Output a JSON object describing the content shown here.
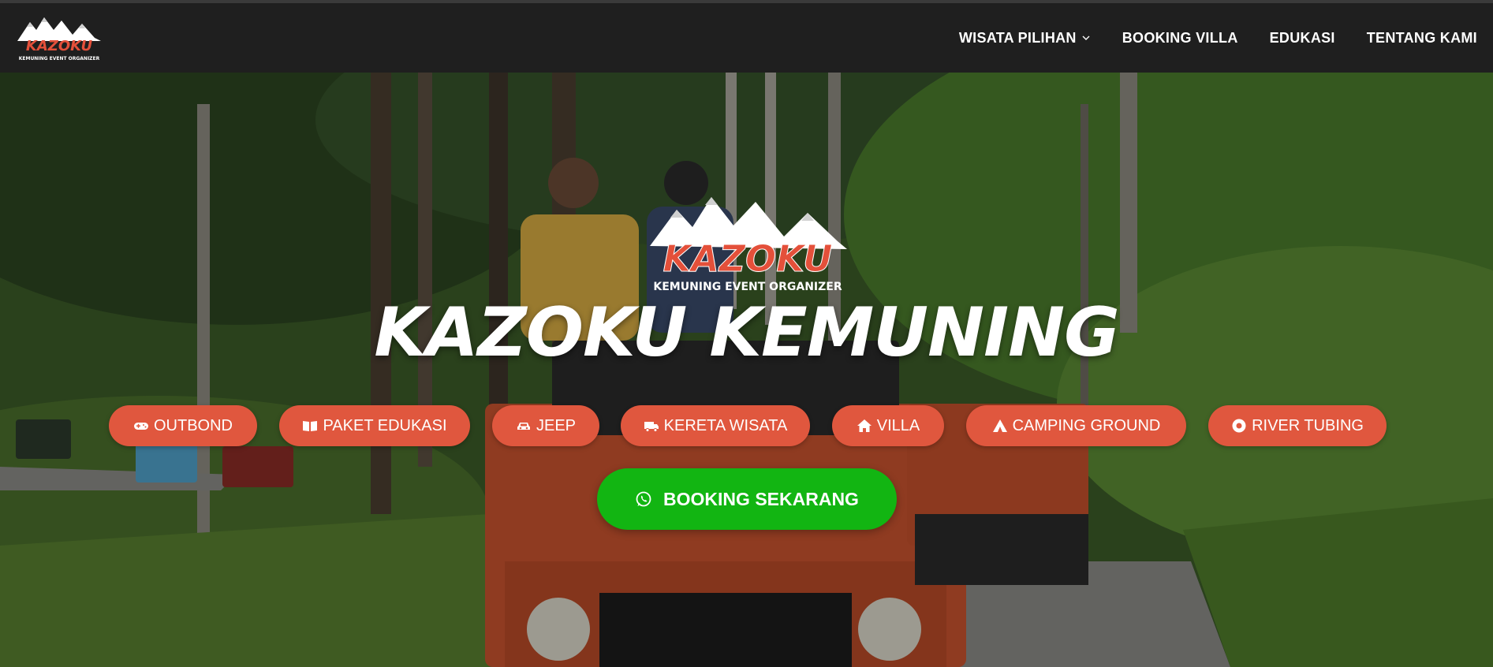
{
  "brand": {
    "logo_text": "KAZOKU",
    "logo_subtext": "KEMUNING EVENT ORGANIZER"
  },
  "nav": {
    "items": [
      {
        "label": "WISATA PILIHAN",
        "has_dropdown": true
      },
      {
        "label": "BOOKING VILLA"
      },
      {
        "label": "EDUKASI"
      },
      {
        "label": "TENTANG KAMI"
      }
    ]
  },
  "hero": {
    "logo_text": "KAZOKU",
    "logo_subtext": "KEMUNING EVENT ORGANIZER",
    "title": "KAZOKU KEMUNING",
    "categories": [
      {
        "label": "OUTBOND",
        "icon": "gamepad-icon"
      },
      {
        "label": "PAKET EDUKASI",
        "icon": "book-open-icon"
      },
      {
        "label": "JEEP",
        "icon": "car-icon"
      },
      {
        "label": "KERETA WISATA",
        "icon": "truck-icon"
      },
      {
        "label": "VILLA",
        "icon": "home-icon"
      },
      {
        "label": "CAMPING GROUND",
        "icon": "campground-icon"
      },
      {
        "label": "RIVER TUBING",
        "icon": "tube-icon"
      }
    ],
    "cta_label": "BOOKING SEKARANG",
    "cta_icon": "whatsapp-icon"
  },
  "colors": {
    "nav_bg": "#1f1f1f",
    "pill_bg": "#e0573e",
    "cta_bg": "#12b512",
    "logo_accent": "#e4503a"
  }
}
